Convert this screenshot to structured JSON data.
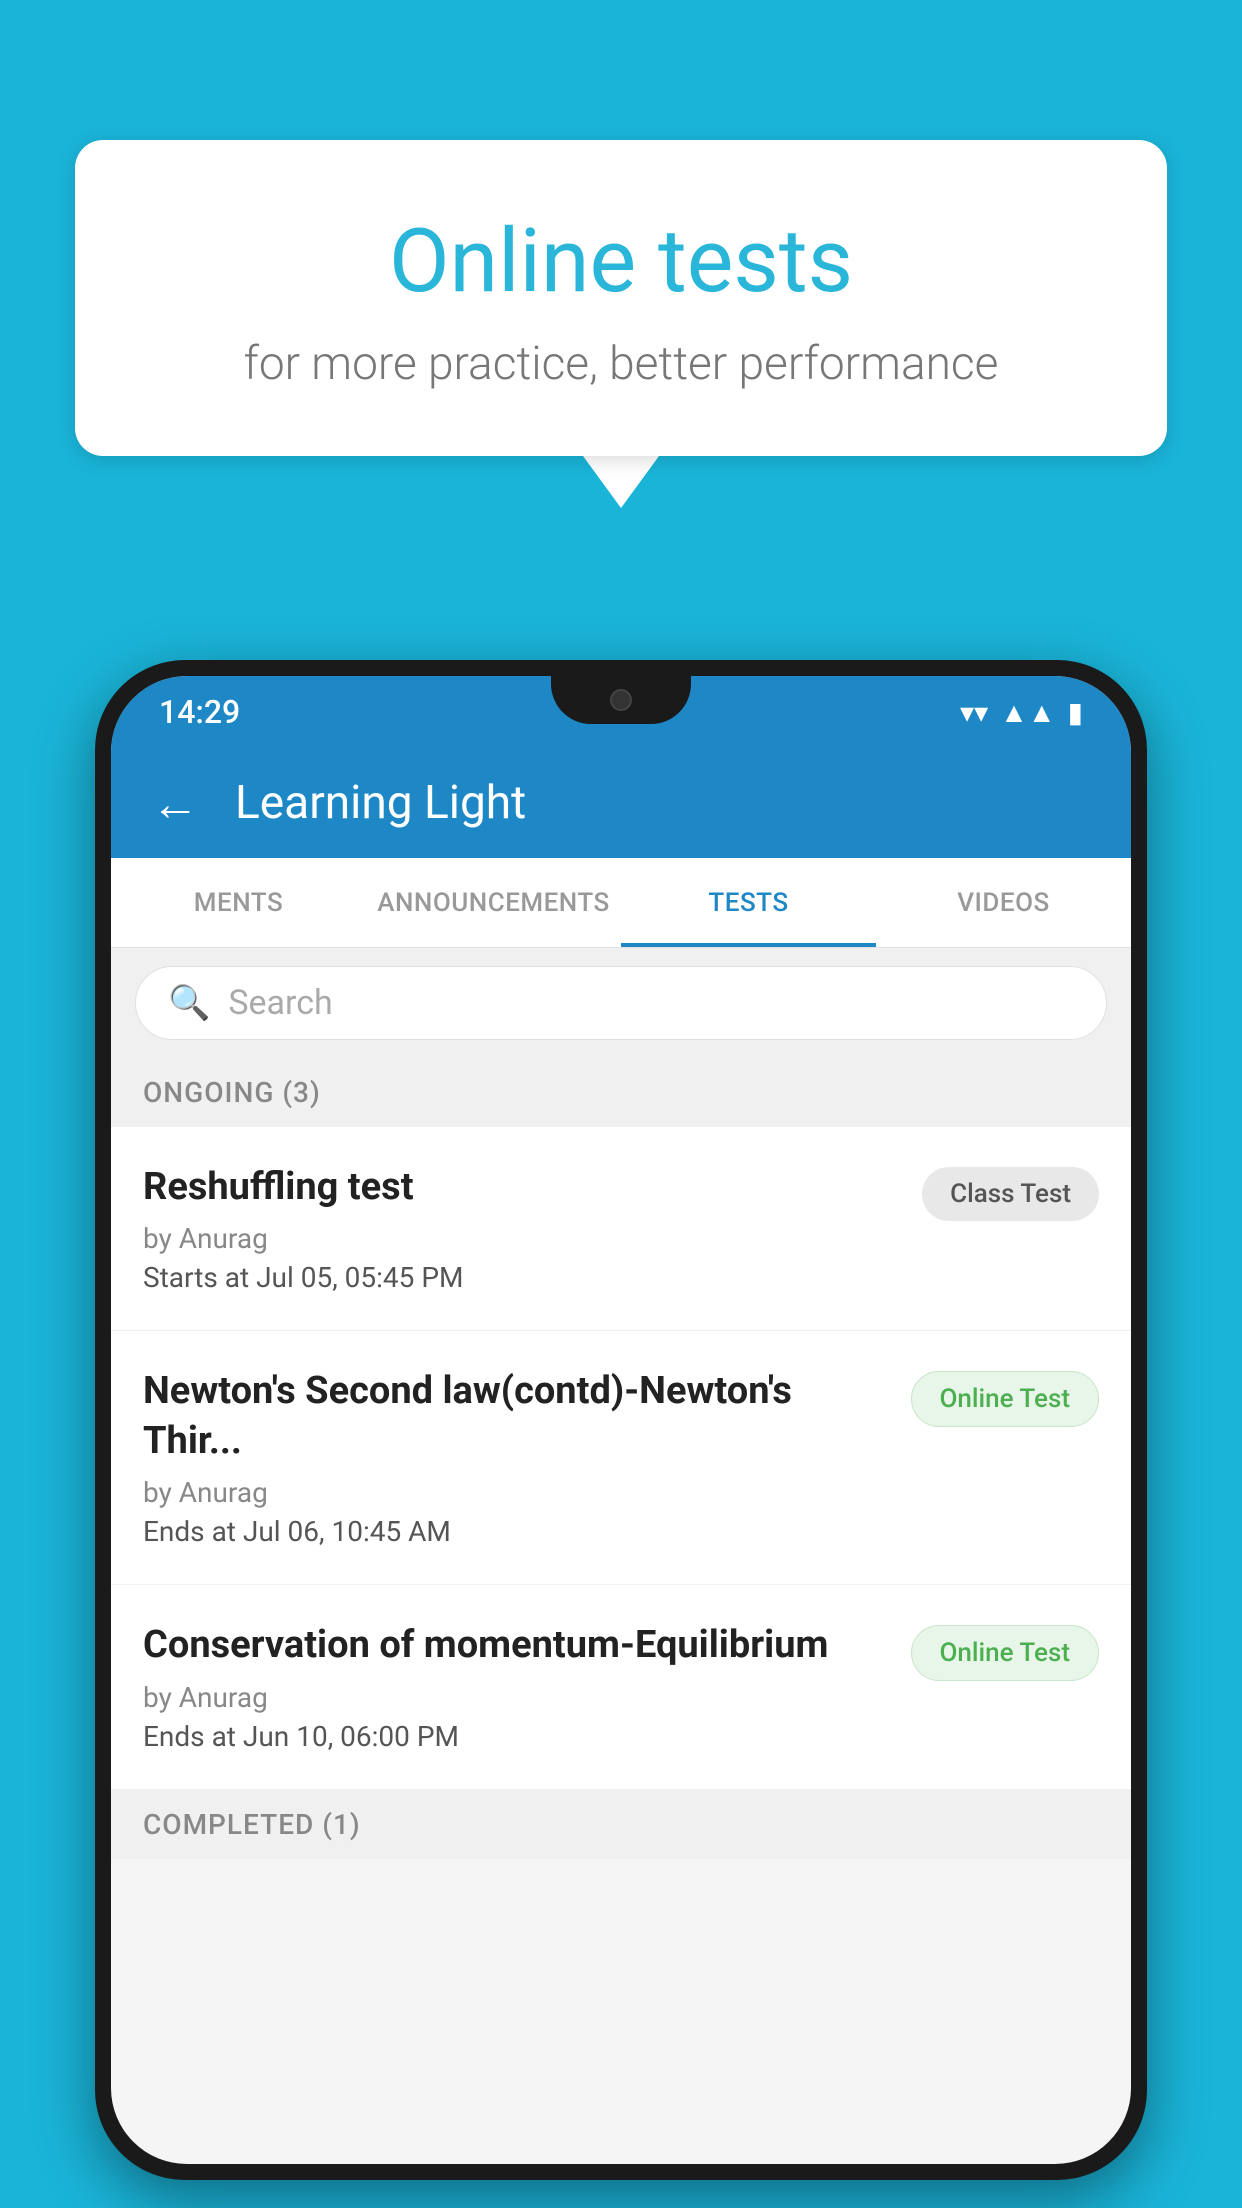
{
  "background_color": "#1ab4d8",
  "speech_bubble": {
    "title": "Online tests",
    "subtitle": "for more practice, better performance"
  },
  "status_bar": {
    "time": "14:29",
    "wifi": "▼",
    "signal": "▲",
    "battery": "▪"
  },
  "app_bar": {
    "title": "Learning Light",
    "back_label": "←"
  },
  "tabs": [
    {
      "label": "MENTS",
      "active": false
    },
    {
      "label": "ANNOUNCEMENTS",
      "active": false
    },
    {
      "label": "TESTS",
      "active": true
    },
    {
      "label": "VIDEOS",
      "active": false
    }
  ],
  "search": {
    "placeholder": "Search"
  },
  "ongoing_section": {
    "label": "ONGOING (3)"
  },
  "tests": [
    {
      "name": "Reshuffling test",
      "author": "by Anurag",
      "date_label": "Starts at",
      "date": "Jul 05, 05:45 PM",
      "badge": "Class Test",
      "badge_type": "class"
    },
    {
      "name": "Newton's Second law(contd)-Newton's Thir...",
      "author": "by Anurag",
      "date_label": "Ends at",
      "date": "Jul 06, 10:45 AM",
      "badge": "Online Test",
      "badge_type": "online"
    },
    {
      "name": "Conservation of momentum-Equilibrium",
      "author": "by Anurag",
      "date_label": "Ends at",
      "date": "Jun 10, 06:00 PM",
      "badge": "Online Test",
      "badge_type": "online"
    }
  ],
  "completed_section": {
    "label": "COMPLETED (1)"
  }
}
